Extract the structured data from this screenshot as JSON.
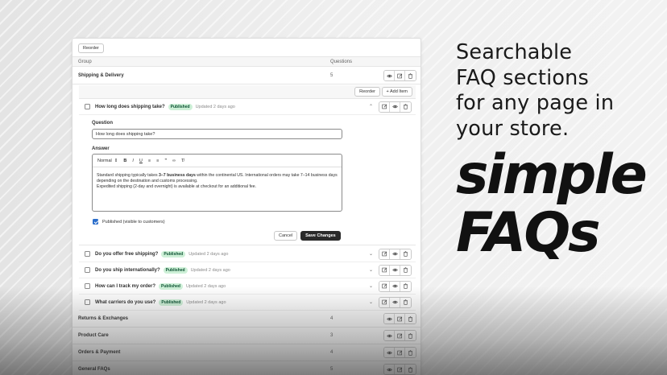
{
  "toolbar": {
    "reorder_label": "Reorder"
  },
  "table": {
    "col_group": "Group",
    "col_questions": "Questions"
  },
  "groups": [
    {
      "name": "Shipping & Delivery",
      "count": "5"
    },
    {
      "name": "Returns & Exchanges",
      "count": "4"
    },
    {
      "name": "Product Care",
      "count": "3"
    },
    {
      "name": "Orders & Payment",
      "count": "4"
    },
    {
      "name": "General FAQs",
      "count": "5"
    }
  ],
  "group_actions": {
    "reorder_label": "Reorder",
    "add_item_label": "+ Add Item"
  },
  "items": [
    {
      "question": "How long does shipping take?",
      "badge": "Published",
      "updated": "Updated 2 days ago"
    },
    {
      "question": "Do you offer free shipping?",
      "badge": "Published",
      "updated": "Updated 2 days ago"
    },
    {
      "question": "Do you ship internationally?",
      "badge": "Published",
      "updated": "Updated 2 days ago"
    },
    {
      "question": "How can I track my order?",
      "badge": "Published",
      "updated": "Updated 2 days ago"
    },
    {
      "question": "What carriers do you use?",
      "badge": "Published",
      "updated": "Updated 2 days ago"
    }
  ],
  "editor": {
    "question_label": "Question",
    "question_value": "How long does shipping take?",
    "answer_label": "Answer",
    "format_select": "Normal",
    "answer_p1_a": "Standard shipping typically takes ",
    "answer_p1_bold": "3–7 business days",
    "answer_p1_b": " within the continental US. International orders may take 7–14 business days depending on the destination and customs processing.",
    "answer_p2": "Expedited shipping (2-day and overnight) is available at checkout for an additional fee.",
    "published_label": "Published (visible to customers)",
    "cancel_label": "Cancel",
    "save_label": "Save Changes"
  },
  "marketing": {
    "tagline_lines": [
      "Searchable",
      "FAQ sections",
      "for any page in",
      "your store."
    ],
    "logo_lines": [
      "simple",
      "FAQs"
    ]
  },
  "colors": {
    "accent": "#2c6ecb",
    "badge_bg": "#cdf0d7",
    "badge_text": "#0c5132",
    "primary_button": "#2a2a2a"
  }
}
